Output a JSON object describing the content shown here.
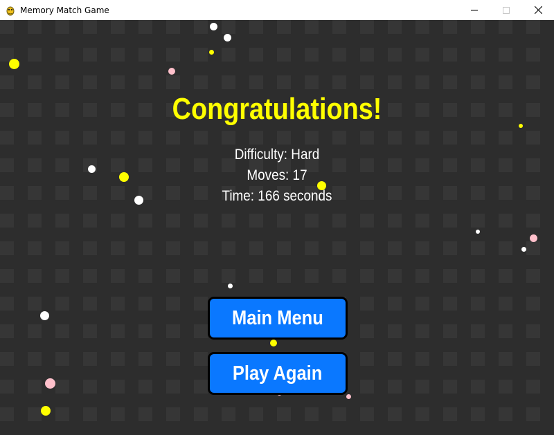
{
  "window": {
    "title": "Memory Match Game",
    "controls": [
      "minimize",
      "maximize",
      "close"
    ]
  },
  "colors": {
    "background": "#2d2d2d",
    "tile": "#363636",
    "title_text": "#ffff00",
    "button": "#0a78ff",
    "confetti_yellow": "#ffff00",
    "confetti_white": "#ffffff",
    "confetti_pink": "#ffc0cb"
  },
  "game_over": {
    "heading": "Congratulations!",
    "difficulty_text": "Difficulty: Hard",
    "moves_text": "Moves: 17",
    "time_text": "Time: 166 seconds"
  },
  "buttons": {
    "main_menu": "Main Menu",
    "play_again": "Play Again"
  },
  "confetti_colors": [
    "yellow",
    "white",
    "pink"
  ]
}
